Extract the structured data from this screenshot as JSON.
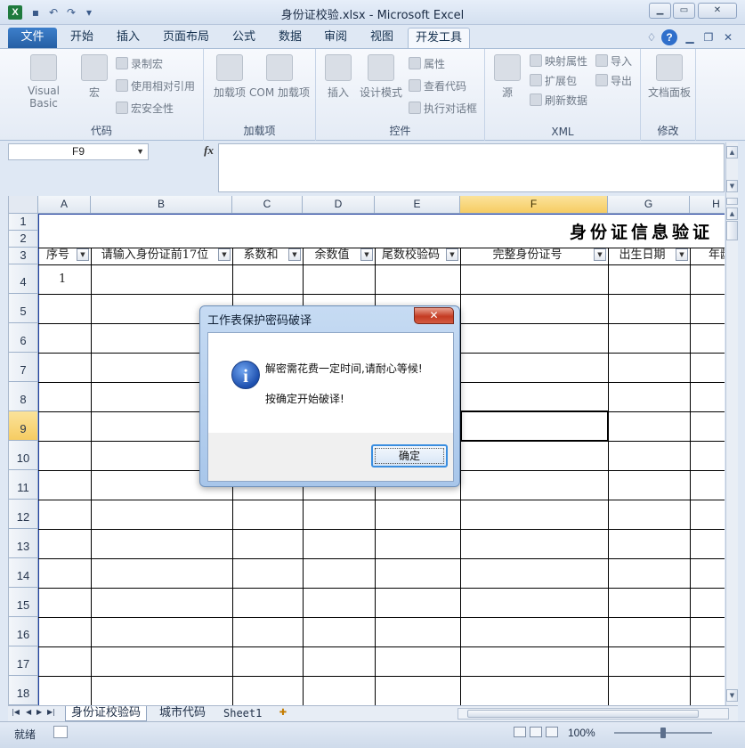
{
  "window": {
    "title": "身份证校验.xlsx - Microsoft Excel",
    "app_icon": "X"
  },
  "quick_access": {
    "icons": [
      "save-icon",
      "undo-icon",
      "redo-icon",
      "customize-icon"
    ]
  },
  "ribbon": {
    "tabs": [
      "文件",
      "开始",
      "插入",
      "页面布局",
      "公式",
      "数据",
      "审阅",
      "视图",
      "开发工具"
    ],
    "active_tab": "开发工具",
    "groups": {
      "code": {
        "label": "代码",
        "visual_basic": "Visual Basic",
        "macro": "宏",
        "record_macro": "录制宏",
        "relative_ref": "使用相对引用",
        "macro_security": "宏安全性"
      },
      "addins": {
        "label": "加载项",
        "addins": "加载项",
        "com_addins": "COM 加载项"
      },
      "controls": {
        "label": "控件",
        "insert": "插入",
        "design_mode": "设计模式",
        "properties": "属性",
        "view_code": "查看代码",
        "run_dialog": "执行对话框"
      },
      "xml": {
        "label": "XML",
        "source": "源",
        "map_properties": "映射属性",
        "expansion_packs": "扩展包",
        "refresh_data": "刷新数据",
        "import": "导入",
        "export": "导出"
      },
      "modify": {
        "label": "修改",
        "document_panel": "文档面板"
      }
    }
  },
  "formula_bar": {
    "name_box": "F9",
    "fx_label": "fx",
    "content": ""
  },
  "sheet": {
    "columns": [
      "A",
      "B",
      "C",
      "D",
      "E",
      "F",
      "G",
      "H"
    ],
    "selected_column": "F",
    "rows": [
      "1",
      "2",
      "3",
      "4",
      "5",
      "6",
      "7",
      "8",
      "9",
      "10",
      "11",
      "12",
      "13",
      "14",
      "15",
      "16",
      "17",
      "18"
    ],
    "selected_row": "9",
    "title": "身份证信息验证",
    "headers": [
      "序号",
      "请输入身份证前17位",
      "系数和",
      "余数值",
      "尾数校验码",
      "完整身份证号",
      "出生日期",
      "年龄"
    ],
    "cell_a4": "1"
  },
  "sheet_tabs": {
    "tabs": [
      "身份证校验码",
      "城市代码",
      "Sheet1"
    ],
    "active": "身份证校验码"
  },
  "status_bar": {
    "ready": "就绪",
    "zoom": "100%"
  },
  "dialog": {
    "title": "工作表保护密码破译",
    "close": "✕",
    "icon": "i",
    "message_line1": "解密需花费一定时间,请耐心等候!",
    "message_line2": "按确定开始破译!",
    "ok_button": "确定"
  }
}
